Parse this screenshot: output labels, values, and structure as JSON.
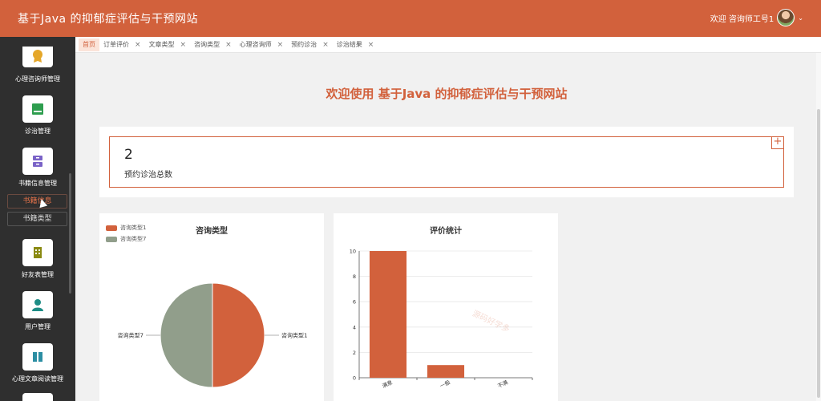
{
  "header": {
    "title": "基于Java 的抑郁症评估与干预网站",
    "welcome_user": "欢迎 咨询师工号1"
  },
  "sidebar": {
    "items": [
      {
        "label": "心理咨询师管理",
        "icon": "award-icon"
      },
      {
        "label": "诊治管理",
        "icon": "card-icon"
      },
      {
        "label": "书籍信息管理",
        "icon": "cabinet-icon"
      },
      {
        "label": "好友表管理",
        "icon": "building-icon"
      },
      {
        "label": "用户管理",
        "icon": "person-icon"
      },
      {
        "label": "心理文章阅读管理",
        "icon": "book-icon"
      }
    ],
    "subitems": [
      "书籍信息",
      "书籍类型"
    ]
  },
  "tabs": [
    {
      "label": "首页",
      "active": true
    },
    {
      "label": "订单评价"
    },
    {
      "label": "文章类型"
    },
    {
      "label": "咨询类型"
    },
    {
      "label": "心理咨询师"
    },
    {
      "label": "预约诊治"
    },
    {
      "label": "诊治结果"
    }
  ],
  "main": {
    "welcome": "欢迎使用 基于Java 的抑郁症评估与干预网站",
    "stat": {
      "value": "2",
      "label": "预约诊治总数"
    }
  },
  "colors": {
    "accent": "#d2613c",
    "pie_secondary": "#919e8b"
  },
  "watermarks": [
    "源码好学多"
  ],
  "chart_data": [
    {
      "type": "pie",
      "title": "咨询类型",
      "categories": [
        "咨询类型1",
        "咨询类型7"
      ],
      "values": [
        1,
        1
      ],
      "legend": "top-left"
    },
    {
      "type": "bar",
      "title": "评价统计",
      "categories": [
        "满意",
        "一般",
        "不满"
      ],
      "values": [
        10,
        1,
        0
      ],
      "ylim": [
        0,
        10
      ],
      "yticks": [
        0,
        2,
        4,
        6,
        8,
        10
      ],
      "grid": true
    }
  ]
}
